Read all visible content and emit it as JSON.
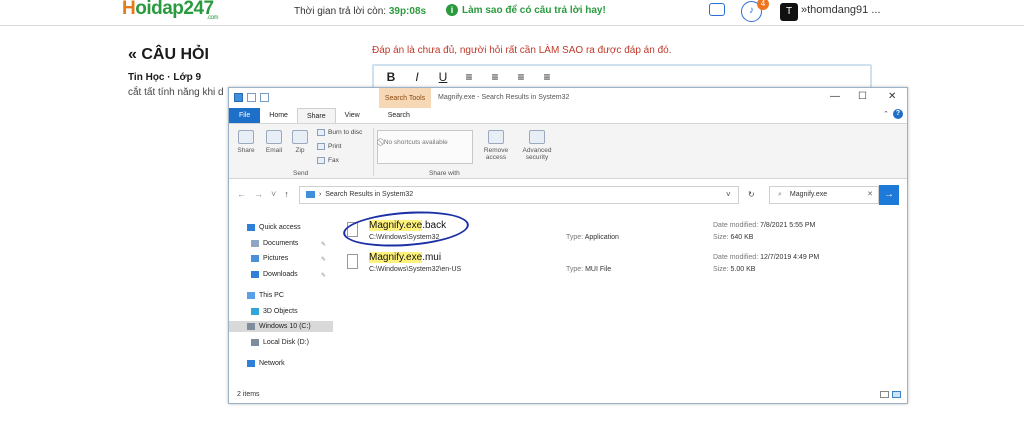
{
  "site": {
    "logo_main": "oidap247",
    "logo_h": "H",
    "logo_sub": ".com",
    "timer_label": "Thời gian trả lời còn:",
    "timer_value": "39p:08s",
    "hint_text": "Làm sao để có câu trả lời hay!",
    "notifications_count": "4",
    "avatar_letter": "T",
    "username": "thomdang91 ...",
    "username_chevron": "»"
  },
  "question": {
    "heading": "« CÂU HỎI",
    "subject": "Tin Học · Lớp 9",
    "text": "cắt tất tính năng khi d",
    "notice": "Đáp án là chưa đủ, người hỏi rất cần LÀM SAO ra được đáp án đó."
  },
  "editor": {
    "tools": [
      "B",
      "I",
      "U",
      "≡",
      "≡",
      "≡",
      "≡"
    ]
  },
  "explorer": {
    "search_tools_label": "Search Tools",
    "window_title": "Magnify.exe - Search Results in System32",
    "window_buttons": [
      "—",
      "☐",
      "✕"
    ],
    "ribbon_tabs": [
      "File",
      "Home",
      "Share",
      "View",
      "Search"
    ],
    "ribbon": {
      "share_label": "Share",
      "email_label": "Email",
      "zip_label": "Zip",
      "burn_label": "Burn to disc",
      "print_label": "Print",
      "fax_label": "Fax",
      "shortcuts_label": "No shortcuts available",
      "remove_access_label": "Remove access",
      "advanced_security_label": "Advanced security",
      "group_send": "Send",
      "group_share_with": "Share with"
    },
    "address": {
      "path": "Search Results in System32",
      "search_query": "Magnify.exe"
    },
    "nav": [
      {
        "label": "Quick access",
        "color": "#2f7fd6"
      },
      {
        "label": "Documents",
        "color": "#8ea6c4"
      },
      {
        "label": "Pictures",
        "color": "#4a90d9"
      },
      {
        "label": "Downloads",
        "color": "#2f7fd6"
      },
      {
        "label": "This PC",
        "color": "#5aa0e8"
      },
      {
        "label": "3D Objects",
        "color": "#2fa7d8"
      },
      {
        "label": "Windows 10 (C:)",
        "color": "#7f8c9d"
      },
      {
        "label": "Local Disk (D:)",
        "color": "#7f8c9d"
      },
      {
        "label": "Network",
        "color": "#2f7fd6"
      }
    ],
    "files": [
      {
        "name_highlight": "Magnify.exe",
        "name_rest": ".back",
        "path": "C:\\Windows\\System32",
        "type_label": "Type:",
        "type": "Application",
        "modified_label": "Date modified:",
        "modified": "7/8/2021 5:55 PM",
        "size_label": "Size:",
        "size": "640 KB"
      },
      {
        "name_highlight": "Magnify.exe",
        "name_rest": ".mui",
        "path": "C:\\Windows\\System32\\en-US",
        "type_label": "Type:",
        "type": "MUI File",
        "modified_label": "Date modified:",
        "modified": "12/7/2019 4:49 PM",
        "size_label": "Size:",
        "size": "5.00 KB"
      }
    ],
    "status": "2 items"
  }
}
